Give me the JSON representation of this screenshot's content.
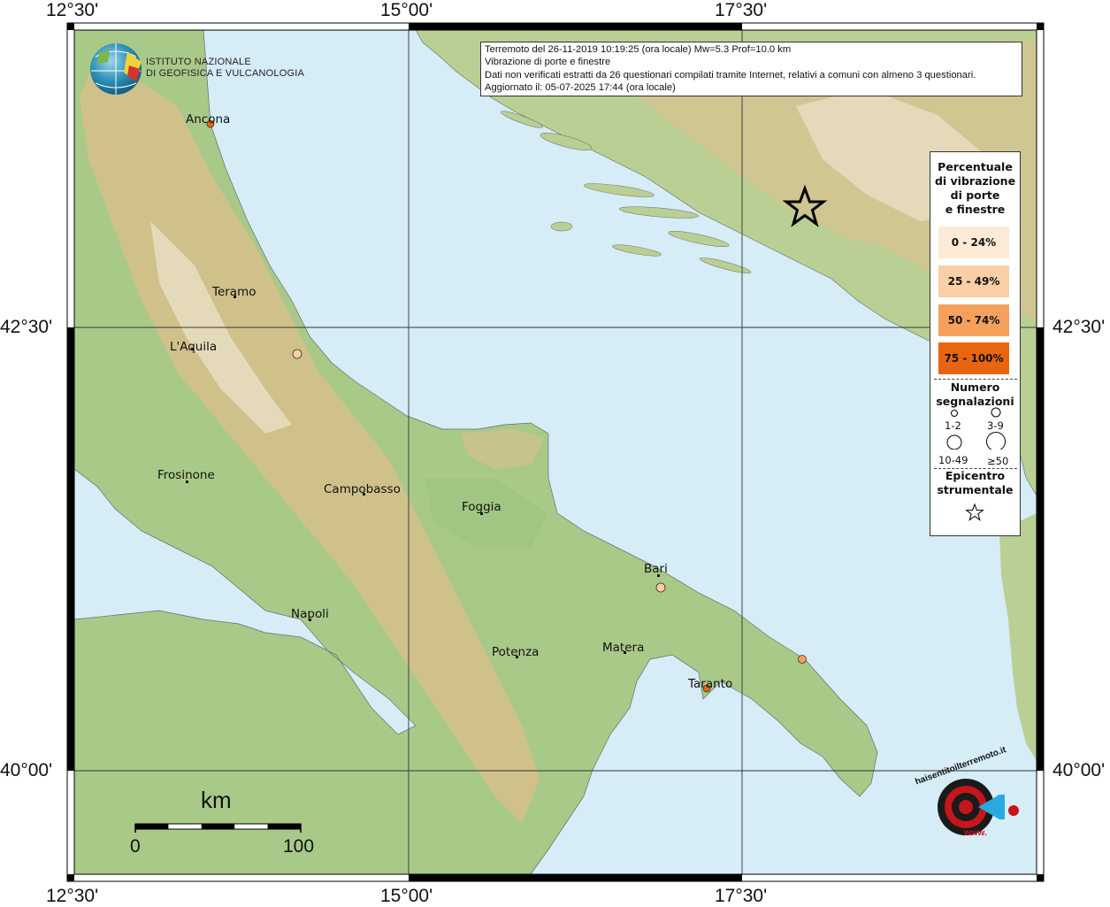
{
  "map": {
    "info": {
      "line1": "Terremoto del 26-11-2019 10:19:25 (ora locale) Mw=5.3 Prof=10.0 km",
      "line2": "Vibrazione di porte e finestre",
      "line3": "Dati non verificati estratti da 26 questionari compilati tramite Internet, relativi a comuni con almeno 3 questionari.",
      "line4": "Aggiornato il: 05-07-2025 17:44 (ora locale)"
    },
    "coords": {
      "top": [
        "12°30'",
        "15°00'",
        "17°30'"
      ],
      "bottom": [
        "12°30'",
        "15°00'",
        "17°30'"
      ],
      "left": [
        "42°30'",
        "40°00'"
      ],
      "right": [
        "42°30'",
        "40°00'"
      ]
    },
    "institute": {
      "line1": "ISTITUTO NAZIONALE",
      "line2": "DI GEOFISICA E VULCANOLOGIA"
    },
    "cities": [
      {
        "name": "Ancona"
      },
      {
        "name": "Teramo"
      },
      {
        "name": "L'Aquila"
      },
      {
        "name": "Frosinone"
      },
      {
        "name": "Campobasso"
      },
      {
        "name": "Foggia"
      },
      {
        "name": "Napoli"
      },
      {
        "name": "Potenza"
      },
      {
        "name": "Matera"
      },
      {
        "name": "Bari"
      },
      {
        "name": "Taranto"
      }
    ],
    "legend": {
      "title_lines": [
        "Percentuale",
        "di vibrazione",
        "di porte",
        "e finestre"
      ],
      "classes": [
        {
          "label": "0 - 24%",
          "color": "#fdebd7"
        },
        {
          "label": "25 - 49%",
          "color": "#f9cfa6"
        },
        {
          "label": "50 - 74%",
          "color": "#f5a15d"
        },
        {
          "label": "75 - 100%",
          "color": "#e8660f"
        }
      ],
      "count_title_lines": [
        "Numero",
        "segnalazioni"
      ],
      "sizes": [
        "1-2",
        "3-9",
        "10-49",
        "≥50"
      ],
      "epicenter_lines": [
        "Epicentro",
        "strumentale"
      ]
    },
    "scale": {
      "unit": "km",
      "min": "0",
      "max": "100"
    },
    "badge": {
      "text": "haisentitoilterremoto.it",
      "url": "www."
    }
  }
}
